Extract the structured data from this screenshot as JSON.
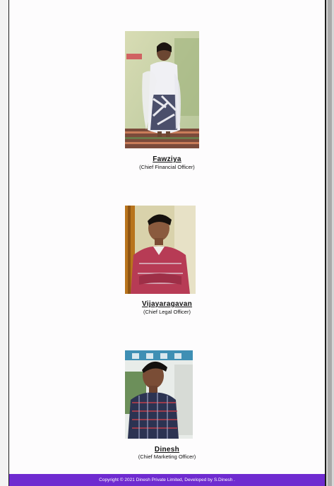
{
  "team": [
    {
      "name": "Fawziya",
      "role": "(Chief Financial Officer)",
      "photo": "woman-in-white-saree-photo"
    },
    {
      "name": "Vijayaragavan",
      "role": "(Chief Legal Officer)",
      "photo": "man-in-red-shirt-photo"
    },
    {
      "name": "Dinesh",
      "role": "(Chief Marketing Officer)",
      "photo": "man-in-plaid-shirt-photo"
    }
  ],
  "footer": {
    "text": "Copyright © 2021 Dinesh Private Limited, Developed by S.Dinesh ."
  },
  "colors": {
    "footer_bg": "#6f2bd0",
    "footer_text": "#ffffff"
  }
}
